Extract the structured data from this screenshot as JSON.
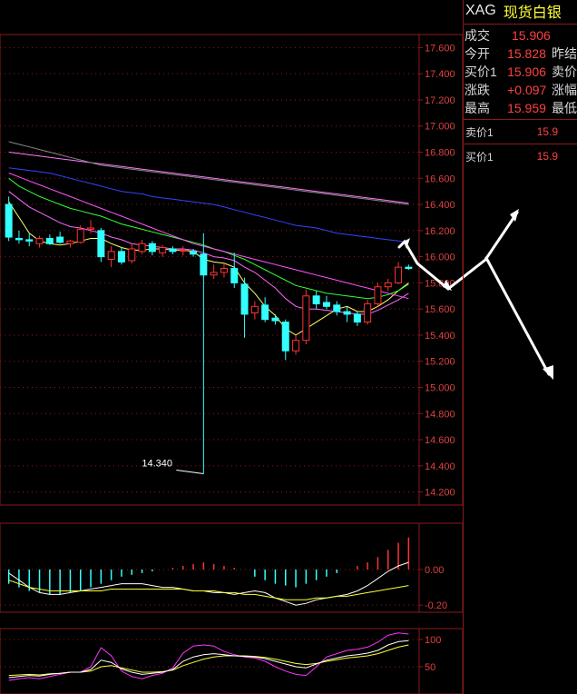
{
  "chart_data": [
    {
      "type": "candlestick",
      "ylim": [
        14.1,
        17.7
      ],
      "y_ticks": [
        "17.600",
        "17.400",
        "17.200",
        "17.000",
        "16.800",
        "16.600",
        "16.400",
        "16.200",
        "16.000",
        "15.800",
        "15.600",
        "15.400",
        "15.200",
        "15.000",
        "14.800",
        "14.600",
        "14.400",
        "14.200"
      ],
      "annotation": "14.340",
      "candles": [
        {
          "o": 16.4,
          "h": 16.46,
          "l": 16.12,
          "c": 16.15
        },
        {
          "o": 16.14,
          "h": 16.2,
          "l": 16.1,
          "c": 16.13
        },
        {
          "o": 16.13,
          "h": 16.18,
          "l": 16.08,
          "c": 16.12
        },
        {
          "o": 16.1,
          "h": 16.16,
          "l": 16.07,
          "c": 16.14
        },
        {
          "o": 16.14,
          "h": 16.17,
          "l": 16.09,
          "c": 16.1
        },
        {
          "o": 16.15,
          "h": 16.19,
          "l": 16.1,
          "c": 16.11
        },
        {
          "o": 16.1,
          "h": 16.13,
          "l": 16.07,
          "c": 16.12
        },
        {
          "o": 16.11,
          "h": 16.24,
          "l": 16.1,
          "c": 16.21
        },
        {
          "o": 16.21,
          "h": 16.28,
          "l": 16.18,
          "c": 16.22
        },
        {
          "o": 16.2,
          "h": 16.22,
          "l": 15.96,
          "c": 16.0
        },
        {
          "o": 15.98,
          "h": 16.08,
          "l": 15.92,
          "c": 16.04
        },
        {
          "o": 16.04,
          "h": 16.07,
          "l": 15.94,
          "c": 15.96
        },
        {
          "o": 15.97,
          "h": 16.1,
          "l": 15.95,
          "c": 16.06
        },
        {
          "o": 16.04,
          "h": 16.13,
          "l": 16.02,
          "c": 16.1
        },
        {
          "o": 16.1,
          "h": 16.12,
          "l": 16.01,
          "c": 16.04
        },
        {
          "o": 16.03,
          "h": 16.09,
          "l": 16.0,
          "c": 16.07
        },
        {
          "o": 16.06,
          "h": 16.08,
          "l": 16.02,
          "c": 16.04
        },
        {
          "o": 16.05,
          "h": 16.08,
          "l": 16.01,
          "c": 16.05
        },
        {
          "o": 16.04,
          "h": 16.06,
          "l": 16.0,
          "c": 16.02
        },
        {
          "o": 16.02,
          "h": 16.18,
          "l": 14.34,
          "c": 15.86
        },
        {
          "o": 15.86,
          "h": 15.94,
          "l": 15.83,
          "c": 15.88
        },
        {
          "o": 15.88,
          "h": 15.95,
          "l": 15.84,
          "c": 15.91
        },
        {
          "o": 15.91,
          "h": 16.03,
          "l": 15.76,
          "c": 15.8
        },
        {
          "o": 15.79,
          "h": 15.84,
          "l": 15.38,
          "c": 15.56
        },
        {
          "o": 15.57,
          "h": 15.66,
          "l": 15.52,
          "c": 15.62
        },
        {
          "o": 15.63,
          "h": 15.69,
          "l": 15.5,
          "c": 15.52
        },
        {
          "o": 15.53,
          "h": 15.56,
          "l": 15.48,
          "c": 15.51
        },
        {
          "o": 15.5,
          "h": 15.52,
          "l": 15.21,
          "c": 15.28
        },
        {
          "o": 15.28,
          "h": 15.4,
          "l": 15.25,
          "c": 15.36
        },
        {
          "o": 15.36,
          "h": 15.75,
          "l": 15.33,
          "c": 15.7
        },
        {
          "o": 15.7,
          "h": 15.74,
          "l": 15.6,
          "c": 15.64
        },
        {
          "o": 15.65,
          "h": 15.7,
          "l": 15.6,
          "c": 15.62
        },
        {
          "o": 15.63,
          "h": 15.66,
          "l": 15.55,
          "c": 15.58
        },
        {
          "o": 15.58,
          "h": 15.62,
          "l": 15.5,
          "c": 15.56
        },
        {
          "o": 15.56,
          "h": 15.58,
          "l": 15.47,
          "c": 15.5
        },
        {
          "o": 15.5,
          "h": 15.67,
          "l": 15.48,
          "c": 15.64
        },
        {
          "o": 15.64,
          "h": 15.8,
          "l": 15.62,
          "c": 15.77
        },
        {
          "o": 15.77,
          "h": 15.83,
          "l": 15.74,
          "c": 15.8
        },
        {
          "o": 15.8,
          "h": 15.96,
          "l": 15.79,
          "c": 15.92
        },
        {
          "o": 15.92,
          "h": 15.94,
          "l": 15.9,
          "c": 15.91
        }
      ],
      "ma_lines": [
        {
          "color": "#ffff66",
          "values": [
            16.42,
            16.3,
            16.18,
            16.12,
            16.1,
            16.09,
            16.1,
            16.12,
            16.14,
            16.14,
            16.1,
            16.07,
            16.05,
            16.05,
            16.06,
            16.06,
            16.05,
            16.05,
            16.04,
            15.98,
            15.96,
            15.95,
            15.92,
            15.8,
            15.72,
            15.62,
            15.55,
            15.45,
            15.4,
            15.45,
            15.5,
            15.55,
            15.6,
            15.62,
            15.58,
            15.58,
            15.62,
            15.67,
            15.74,
            15.8
          ]
        },
        {
          "color": "#ff66ff",
          "values": [
            16.5,
            16.44,
            16.38,
            16.34,
            16.3,
            16.26,
            16.23,
            16.22,
            16.2,
            16.18,
            16.15,
            16.13,
            16.1,
            16.09,
            16.08,
            16.07,
            16.06,
            16.06,
            16.05,
            16.03,
            16.0,
            15.99,
            15.97,
            15.92,
            15.88,
            15.82,
            15.76,
            15.68,
            15.62,
            15.6,
            15.6,
            15.59,
            15.58,
            15.57,
            15.56,
            15.56,
            15.59,
            15.63,
            15.67,
            15.72
          ]
        },
        {
          "color": "#33ff33",
          "values": [
            16.6,
            16.54,
            16.5,
            16.46,
            16.43,
            16.4,
            16.37,
            16.35,
            16.33,
            16.31,
            16.28,
            16.25,
            16.23,
            16.21,
            16.19,
            16.17,
            16.15,
            16.13,
            16.11,
            16.09,
            16.06,
            16.04,
            16.01,
            15.98,
            15.94,
            15.9,
            15.86,
            15.82,
            15.78,
            15.76,
            15.74,
            15.72,
            15.71,
            15.7,
            15.69,
            15.68,
            15.69,
            15.71,
            15.74,
            15.79
          ]
        },
        {
          "color": "#ff55ff",
          "values": [
            16.64,
            16.61,
            16.58,
            16.55,
            16.52,
            16.49,
            16.46,
            16.43,
            16.4,
            16.37,
            16.34,
            16.31,
            16.28,
            16.25,
            16.22,
            16.19,
            16.16,
            16.13,
            16.1,
            16.08,
            16.06,
            16.04,
            16.02,
            16.0,
            15.98,
            15.96,
            15.94,
            15.92,
            15.9,
            15.88,
            15.86,
            15.84,
            15.82,
            15.8,
            15.78,
            15.76,
            15.74,
            15.72,
            15.7,
            15.68
          ]
        },
        {
          "color": "#3344ff",
          "values": [
            16.68,
            16.67,
            16.66,
            16.65,
            16.64,
            16.62,
            16.6,
            16.58,
            16.56,
            16.54,
            16.52,
            16.5,
            16.49,
            16.48,
            16.46,
            16.45,
            16.44,
            16.43,
            16.42,
            16.41,
            16.4,
            16.38,
            16.36,
            16.34,
            16.32,
            16.3,
            16.28,
            16.26,
            16.24,
            16.23,
            16.22,
            16.2,
            16.18,
            16.17,
            16.16,
            16.15,
            16.14,
            16.13,
            16.12,
            16.11
          ]
        },
        {
          "color": "#ff77ff",
          "values": [
            16.8,
            16.79,
            16.78,
            16.77,
            16.76,
            16.75,
            16.74,
            16.73,
            16.72,
            16.71,
            16.7,
            16.69,
            16.68,
            16.67,
            16.66,
            16.65,
            16.64,
            16.63,
            16.62,
            16.61,
            16.6,
            16.59,
            16.58,
            16.57,
            16.56,
            16.55,
            16.54,
            16.53,
            16.52,
            16.51,
            16.5,
            16.49,
            16.48,
            16.47,
            16.46,
            16.45,
            16.44,
            16.43,
            16.42,
            16.41
          ]
        },
        {
          "color": "#888888",
          "values": [
            16.88,
            16.86,
            16.84,
            16.82,
            16.8,
            16.78,
            16.76,
            16.74,
            16.72,
            16.7,
            16.69,
            16.68,
            16.67,
            16.66,
            16.65,
            16.64,
            16.63,
            16.62,
            16.61,
            16.6,
            16.59,
            16.58,
            16.57,
            16.56,
            16.55,
            16.54,
            16.53,
            16.52,
            16.51,
            16.5,
            16.49,
            16.48,
            16.47,
            16.46,
            16.45,
            16.44,
            16.43,
            16.42,
            16.41,
            16.4
          ]
        }
      ]
    },
    {
      "type": "macd",
      "ylim": [
        -0.24,
        0.26
      ],
      "y_ticks": [
        "0.00",
        "-0.20"
      ],
      "histogram": [
        -0.08,
        -0.1,
        -0.12,
        -0.13,
        -0.14,
        -0.14,
        -0.13,
        -0.12,
        -0.1,
        -0.08,
        -0.06,
        -0.04,
        -0.03,
        -0.02,
        -0.01,
        0.0,
        0.01,
        0.02,
        0.03,
        0.04,
        0.03,
        0.02,
        0.01,
        0.0,
        -0.04,
        -0.06,
        -0.08,
        -0.09,
        -0.1,
        -0.08,
        -0.06,
        -0.04,
        -0.02,
        0.0,
        0.02,
        0.04,
        0.07,
        0.11,
        0.15,
        0.18
      ],
      "dif": [
        -0.02,
        -0.06,
        -0.1,
        -0.13,
        -0.14,
        -0.14,
        -0.13,
        -0.12,
        -0.11,
        -0.1,
        -0.09,
        -0.08,
        -0.08,
        -0.08,
        -0.09,
        -0.1,
        -0.1,
        -0.11,
        -0.12,
        -0.12,
        -0.13,
        -0.13,
        -0.14,
        -0.13,
        -0.12,
        -0.13,
        -0.16,
        -0.18,
        -0.2,
        -0.19,
        -0.17,
        -0.16,
        -0.15,
        -0.14,
        -0.12,
        -0.09,
        -0.05,
        -0.01,
        0.02,
        0.04
      ],
      "dea": [
        -0.06,
        -0.08,
        -0.1,
        -0.11,
        -0.12,
        -0.12,
        -0.12,
        -0.12,
        -0.12,
        -0.12,
        -0.11,
        -0.11,
        -0.11,
        -0.11,
        -0.11,
        -0.11,
        -0.11,
        -0.11,
        -0.12,
        -0.12,
        -0.12,
        -0.13,
        -0.13,
        -0.14,
        -0.14,
        -0.15,
        -0.16,
        -0.17,
        -0.17,
        -0.17,
        -0.16,
        -0.16,
        -0.15,
        -0.15,
        -0.14,
        -0.13,
        -0.12,
        -0.11,
        -0.1,
        -0.09
      ]
    },
    {
      "type": "kdj",
      "ylim": [
        0,
        120
      ],
      "y_ticks": [
        "100",
        "50"
      ],
      "k": [
        30,
        32,
        34,
        33,
        36,
        38,
        40,
        40,
        45,
        62,
        58,
        46,
        40,
        36,
        38,
        40,
        45,
        60,
        68,
        72,
        74,
        72,
        70,
        69,
        68,
        65,
        60,
        55,
        50,
        48,
        55,
        62,
        66,
        70,
        72,
        75,
        80,
        90,
        96,
        98
      ],
      "d": [
        34,
        35,
        36,
        35,
        37,
        38,
        40,
        40,
        42,
        50,
        52,
        48,
        44,
        40,
        40,
        41,
        44,
        52,
        58,
        64,
        68,
        70,
        70,
        70,
        69,
        67,
        64,
        60,
        56,
        54,
        56,
        60,
        63,
        66,
        68,
        70,
        74,
        80,
        86,
        90
      ],
      "j": [
        25,
        28,
        30,
        28,
        32,
        36,
        40,
        40,
        50,
        85,
        70,
        42,
        32,
        28,
        34,
        38,
        48,
        75,
        88,
        90,
        88,
        78,
        72,
        68,
        66,
        60,
        50,
        42,
        36,
        34,
        50,
        68,
        74,
        80,
        82,
        86,
        95,
        108,
        112,
        110
      ]
    }
  ],
  "quote": {
    "symbol": "XAG",
    "name": "现货白银",
    "rows": [
      {
        "label": "成交",
        "value": "15.906",
        "label2": ""
      },
      {
        "label": "今开",
        "value": "15.828",
        "label2": "昨结"
      },
      {
        "label": "买价1",
        "value": "15.906",
        "label2": "卖价"
      },
      {
        "label": "涨跌",
        "value": "+0.097",
        "label2": "涨幅"
      },
      {
        "label": "最高",
        "value": "15.959",
        "label2": "最低"
      }
    ],
    "ask": {
      "label": "卖价1",
      "value": "15.9"
    },
    "bid": {
      "label": "买价1",
      "value": "15.9"
    }
  },
  "colors": {
    "grid": "#8b1a1a",
    "axis_text": "#e04040",
    "up": "#ff3333",
    "down": "#33ffff",
    "panel_bg": "#000000",
    "arrow": "#ffffff"
  }
}
